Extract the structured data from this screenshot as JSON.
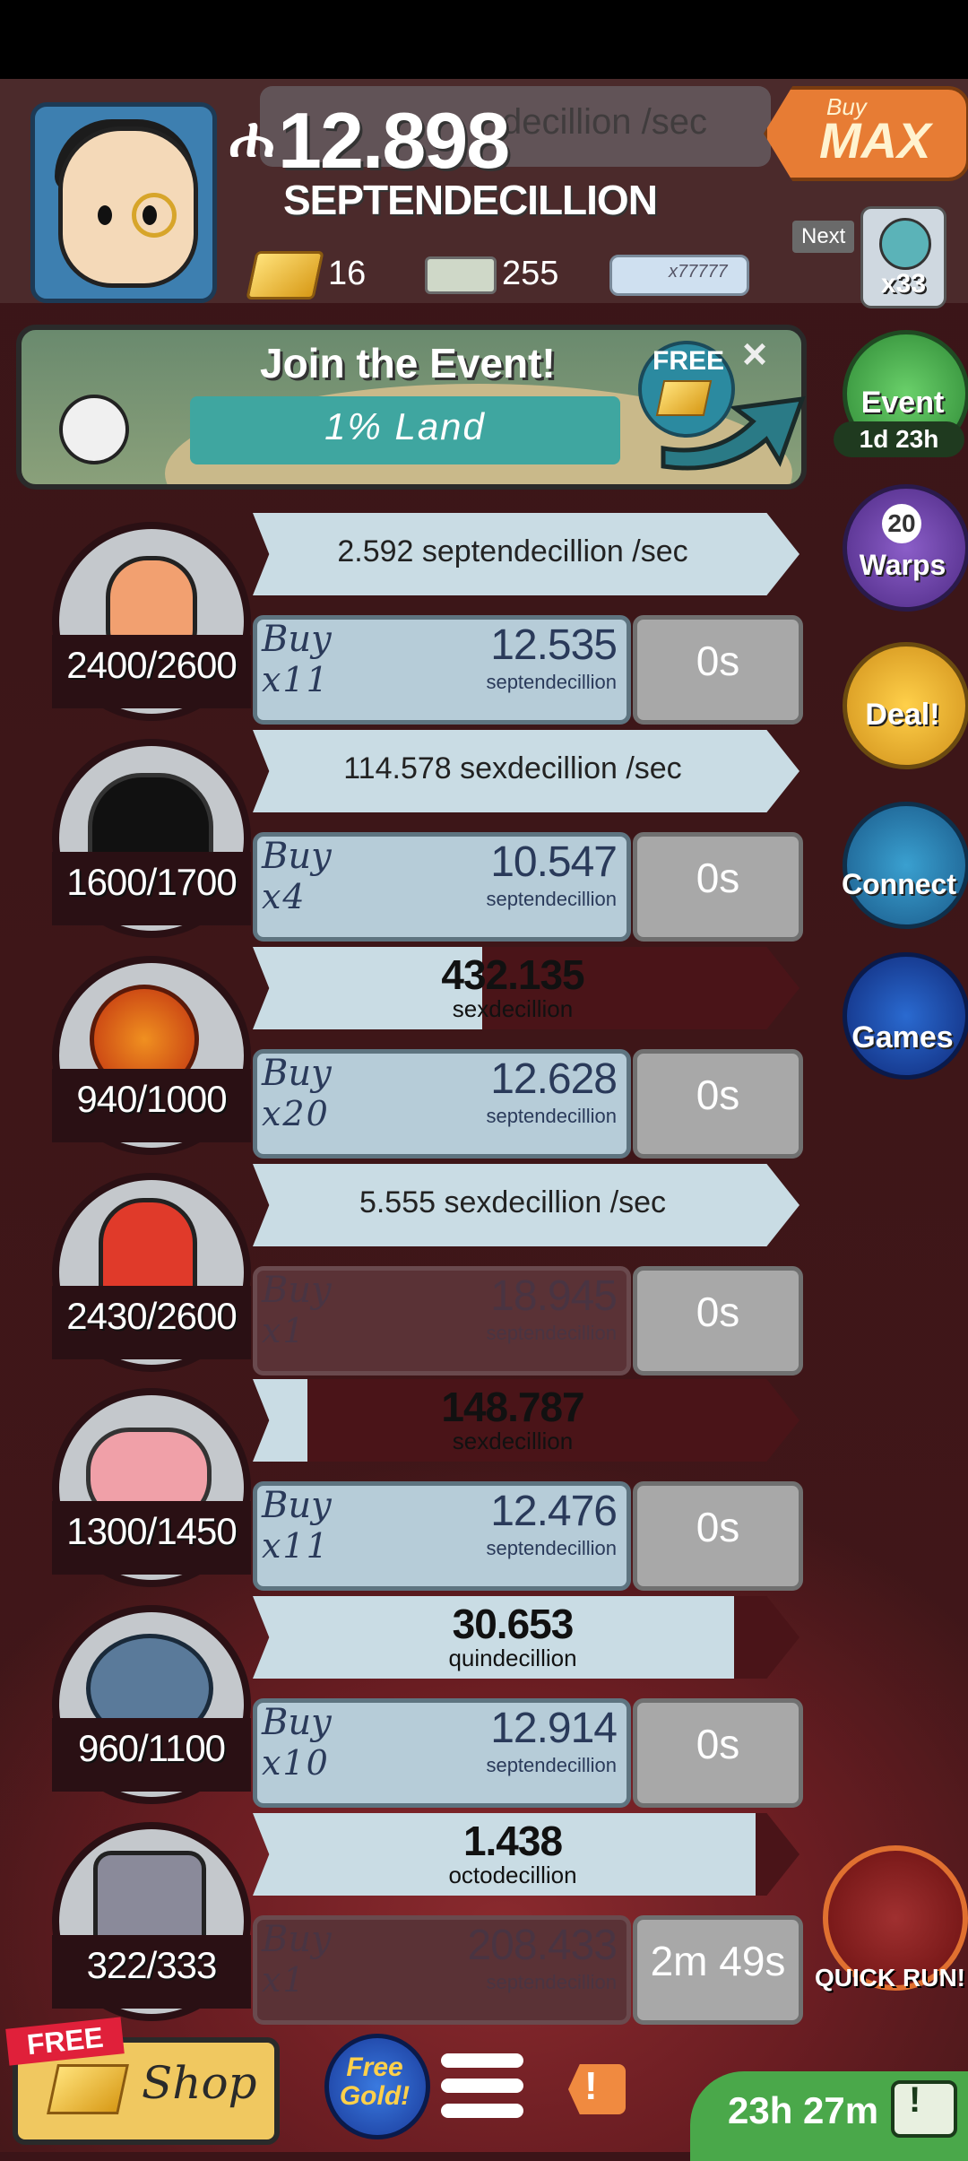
{
  "header": {
    "currency_symbol": "ሐ",
    "currency_value": "12.898",
    "currency_unit": "SEPTENDECILLION",
    "ghost_rate": "decillion /sec",
    "gold": "16",
    "bills": "255",
    "bills2": "x77777",
    "buy_max_small": "Buy",
    "buy_max_big": "MAX",
    "next_label": "Next",
    "next_count": "x33"
  },
  "event_banner": {
    "title": "Join the Event!",
    "subtitle": "1% Land",
    "free_badge": "FREE",
    "close": "×"
  },
  "side": {
    "event_label": "Event",
    "event_timer": "1d 23h",
    "warps_count": "20",
    "warps_label": "Warps",
    "deal_label": "Deal!",
    "connect_label": "Connect",
    "games_label": "Games"
  },
  "rows": [
    {
      "count": "2400/2600",
      "mode": "rate",
      "rate": "2.592 septendecillion /sec",
      "buy": "Buy",
      "mult": "x11",
      "cost": "12.535",
      "cost_unit": "septendecillion",
      "time": "0s",
      "dim": false,
      "progress": 1.0
    },
    {
      "count": "1600/1700",
      "mode": "rate",
      "rate": "114.578 sexdecillion /sec",
      "buy": "Buy",
      "mult": "x4",
      "cost": "10.547",
      "cost_unit": "septendecillion",
      "time": "0s",
      "dim": false,
      "progress": 1.0
    },
    {
      "count": "940/1000",
      "mode": "value",
      "value": "432.135",
      "value_unit": "sexdecillion",
      "buy": "Buy",
      "mult": "x20",
      "cost": "12.628",
      "cost_unit": "septendecillion",
      "time": "0s",
      "dim": false,
      "progress": 0.42
    },
    {
      "count": "2430/2600",
      "mode": "rate",
      "rate": "5.555 sexdecillion /sec",
      "buy": "Buy",
      "mult": "x1",
      "cost": "18.945",
      "cost_unit": "septendecillion",
      "time": "0s",
      "dim": true,
      "progress": 1.0
    },
    {
      "count": "1300/1450",
      "mode": "value",
      "value": "148.787",
      "value_unit": "sexdecillion",
      "buy": "Buy",
      "mult": "x11",
      "cost": "12.476",
      "cost_unit": "septendecillion",
      "time": "0s",
      "dim": false,
      "progress": 0.1
    },
    {
      "count": "960/1100",
      "mode": "value",
      "value": "30.653",
      "value_unit": "quindecillion",
      "buy": "Buy",
      "mult": "x10",
      "cost": "12.914",
      "cost_unit": "septendecillion",
      "time": "0s",
      "dim": false,
      "progress": 0.88
    },
    {
      "count": "322/333",
      "mode": "value",
      "value": "1.438",
      "value_unit": "octodecillion",
      "buy": "Buy",
      "mult": "x1",
      "cost": "208.433",
      "cost_unit": "septendecillion",
      "time": "2m 49s",
      "dim": true,
      "progress": 0.92
    }
  ],
  "bottom": {
    "shop_free": "FREE",
    "shop_label": "Shop",
    "gold_btn": "Free Gold!",
    "alert_mark": "!",
    "timer": "23h 27m",
    "tv_mark": "!",
    "quickrun_label": "QUICK RUN!"
  },
  "colors": {
    "background": "#3b1418",
    "bar_light": "#c9dce4",
    "bar_dark": "#4a1418",
    "buy_button": "#b6ccd8",
    "accent_orange": "#e77c34"
  }
}
